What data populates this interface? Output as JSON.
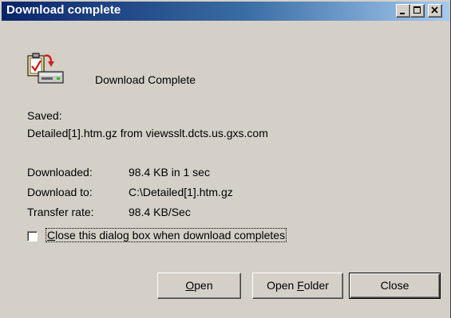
{
  "window": {
    "title": "Download complete"
  },
  "icons": {
    "app": "download-complete-icon",
    "minimize": "minimize-icon",
    "maximize": "maximize-icon",
    "close": "close-icon"
  },
  "content": {
    "heading": "Download Complete",
    "saved_label": "Saved:",
    "saved_value": "Detailed[1].htm.gz from viewsslt.dcts.us.gxs.com",
    "details": [
      {
        "label": "Downloaded:",
        "value": "98.4 KB in 1 sec"
      },
      {
        "label": "Download to:",
        "value": "C:\\Detailed[1].htm.gz"
      },
      {
        "label": "Transfer rate:",
        "value": "98.4 KB/Sec"
      }
    ]
  },
  "options": {
    "close_when_done": {
      "label_first": "C",
      "label_rest": "lose this dialog box when download completes",
      "checked": false
    }
  },
  "buttons": {
    "open": {
      "accel": "O",
      "rest": "pen"
    },
    "open_folder": {
      "before": "Open ",
      "accel": "F",
      "rest": "older"
    },
    "close": "Close"
  },
  "colors": {
    "titlebar_start": "#0a246a",
    "titlebar_end": "#a6caf0",
    "dialog_face": "#d4d0c8"
  }
}
